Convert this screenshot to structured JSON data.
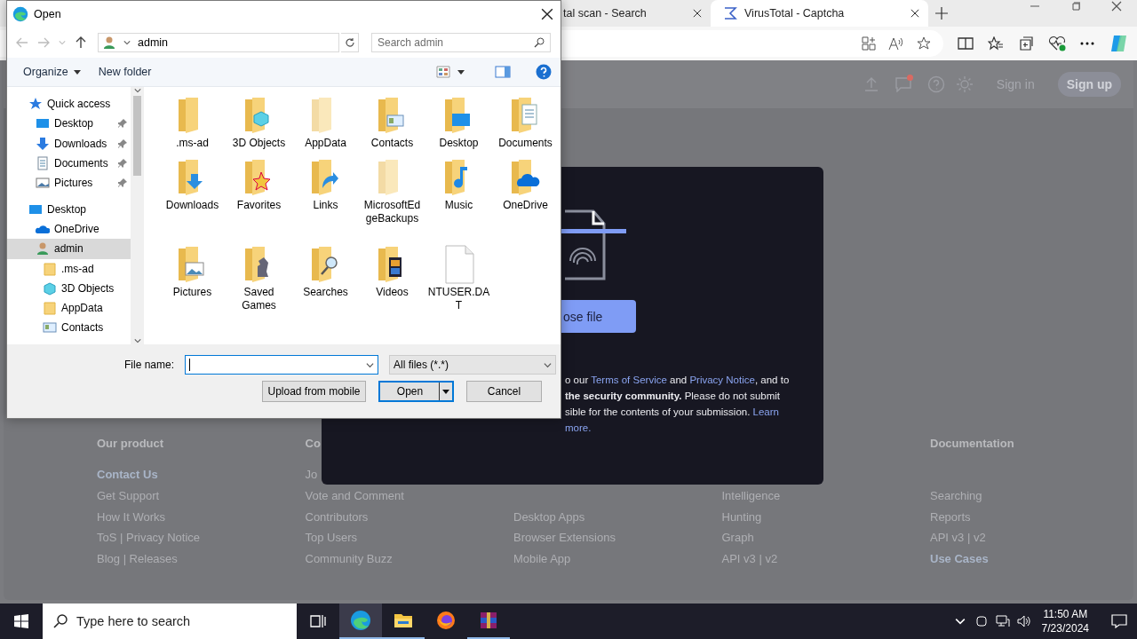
{
  "browser": {
    "tabs": [
      {
        "label": "tal scan - Search",
        "selected": false
      },
      {
        "label": "VirusTotal - Captcha",
        "selected": true
      }
    ]
  },
  "page": {
    "header": {
      "sign_in": "Sign in",
      "sign_up": "Sign up",
      "notification": true
    },
    "footer": [
      {
        "heading": "Our product",
        "links": [
          {
            "label": "Contact Us",
            "highlighted": true
          },
          {
            "label": "Get Support",
            "highlighted": false
          },
          {
            "label": "How It Works",
            "highlighted": false
          },
          {
            "label": "ToS | Privacy Notice",
            "highlighted": false
          },
          {
            "label": "Blog | Releases",
            "highlighted": false
          }
        ]
      },
      {
        "heading": "Co",
        "links": [
          {
            "label": "Jo",
            "highlighted": false
          },
          {
            "label": "Vote and Comment",
            "highlighted": false
          },
          {
            "label": "Contributors",
            "highlighted": false
          },
          {
            "label": "Top Users",
            "highlighted": false
          },
          {
            "label": "Community Buzz",
            "highlighted": false
          }
        ]
      },
      {
        "links": [
          {
            "label": "Desktop Apps",
            "highlighted": false
          },
          {
            "label": "Browser Extensions",
            "highlighted": false
          },
          {
            "label": "Mobile App",
            "highlighted": false
          }
        ]
      },
      {
        "links": [
          {
            "label": "Intelligence",
            "highlighted": false
          },
          {
            "label": "Hunting",
            "highlighted": false
          },
          {
            "label": "Graph",
            "highlighted": false
          },
          {
            "label": "API v3 | v2",
            "highlighted": false
          }
        ]
      },
      {
        "heading": "Documentation",
        "links": [
          {
            "label": "Searching",
            "highlighted": false
          },
          {
            "label": "Reports",
            "highlighted": false
          },
          {
            "label": "API v3 | v2",
            "highlighted": false
          },
          {
            "label": "Use Cases",
            "highlighted": true
          }
        ]
      }
    ]
  },
  "modal": {
    "button": "ose file",
    "lines": [
      [
        {
          "kind": "text",
          "text": "o our "
        },
        {
          "kind": "link",
          "text": "Terms of Service"
        },
        {
          "kind": "text",
          "text": " and "
        },
        {
          "kind": "link",
          "text": "Privacy Notice"
        },
        {
          "kind": "text",
          "text": ", and to"
        }
      ],
      [
        {
          "kind": "bold",
          "text": "the security community."
        },
        {
          "kind": "text",
          "text": " Please do not submit"
        }
      ],
      [
        {
          "kind": "text",
          "text": "sible for the contents of your submission. "
        },
        {
          "kind": "link",
          "text": "Learn"
        }
      ],
      [
        {
          "kind": "link",
          "text": "more."
        }
      ]
    ]
  },
  "dialog": {
    "title": "Open",
    "breadcrumb": "admin",
    "search": {
      "placeholder": "Search admin"
    },
    "commands": [
      "Organize",
      "New folder"
    ],
    "nav": [
      {
        "label": "Quick access",
        "selected": false,
        "children": [
          {
            "label": "Desktop",
            "pinned": true,
            "selected": false
          },
          {
            "label": "Downloads",
            "pinned": true,
            "selected": false
          },
          {
            "label": "Documents",
            "pinned": true,
            "selected": false
          },
          {
            "label": "Pictures",
            "pinned": true,
            "selected": false
          }
        ]
      },
      {
        "label": "Desktop",
        "selected": false,
        "children": [
          {
            "label": "OneDrive",
            "selected": false
          },
          {
            "label": "admin",
            "selected": true,
            "children": [
              {
                "label": ".ms-ad",
                "selected": false
              },
              {
                "label": "3D Objects",
                "selected": false
              },
              {
                "label": "AppData",
                "selected": false
              },
              {
                "label": "Contacts",
                "selected": false
              }
            ]
          }
        ]
      }
    ],
    "items": [
      {
        "label": ".ms-ad",
        "kind": "folder",
        "hidden": false
      },
      {
        "label": "3D Objects",
        "kind": "folder",
        "hidden": false
      },
      {
        "label": "AppData",
        "kind": "folder",
        "hidden": true
      },
      {
        "label": "Contacts",
        "kind": "folder",
        "hidden": false
      },
      {
        "label": "Desktop",
        "kind": "folder",
        "hidden": false
      },
      {
        "label": "Documents",
        "kind": "folder",
        "hidden": false
      },
      {
        "label": "Downloads",
        "kind": "folder",
        "hidden": false
      },
      {
        "label": "Favorites",
        "kind": "folder",
        "hidden": false
      },
      {
        "label": "Links",
        "kind": "folder",
        "hidden": false
      },
      {
        "label": "MicrosoftEdgeBackups",
        "kind": "folder",
        "hidden": true
      },
      {
        "label": "Music",
        "kind": "folder",
        "hidden": false
      },
      {
        "label": "OneDrive",
        "kind": "folder",
        "hidden": false
      },
      {
        "label": "Pictures",
        "kind": "folder",
        "hidden": false
      },
      {
        "label": "Saved Games",
        "kind": "folder",
        "hidden": false
      },
      {
        "label": "Searches",
        "kind": "folder",
        "hidden": false
      },
      {
        "label": "Videos",
        "kind": "folder",
        "hidden": false
      },
      {
        "label": "NTUSER.DAT",
        "kind": "file",
        "hidden": false
      }
    ],
    "file_name_label": "File name:",
    "file_type": "All files (*.*)",
    "buttons": [
      {
        "label": "Upload from mobile",
        "kind": "plain"
      },
      {
        "label": "Open",
        "kind": "split"
      },
      {
        "label": "Cancel",
        "kind": "plain"
      }
    ]
  },
  "taskbar": {
    "search": {
      "placeholder": "Type here to search"
    },
    "apps": [
      {
        "running": true,
        "selected": true
      },
      {
        "running": true,
        "selected": false
      },
      {
        "running": false,
        "selected": false
      },
      {
        "running": true,
        "selected": false
      }
    ],
    "clock": {
      "time": "11:50 AM",
      "date": "7/23/2024"
    }
  }
}
